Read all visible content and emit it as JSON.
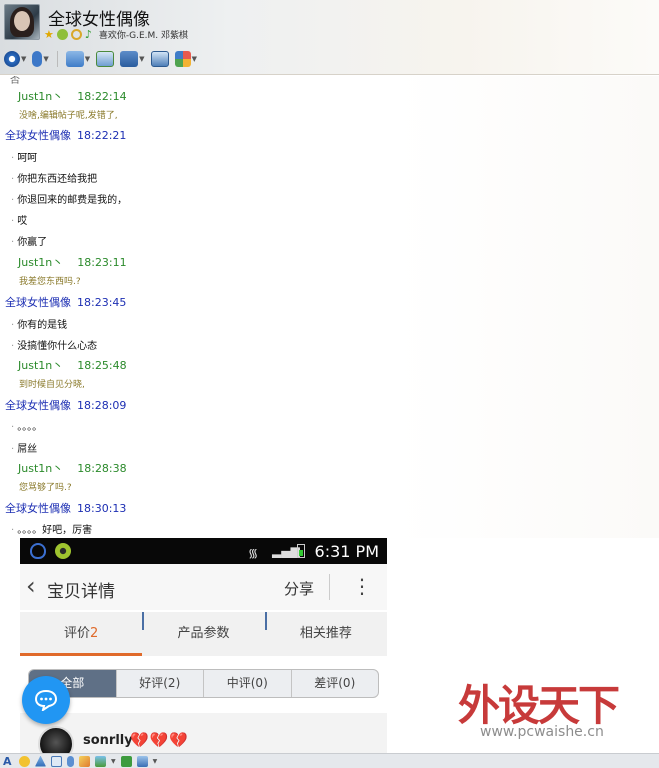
{
  "window": {
    "title": "全球女性偶像",
    "signature": "喜欢你-G.E.M. 邓紫棋"
  },
  "chat": {
    "cutoff_text": "否 ",
    "messages": [
      {
        "sender": "Just1n丶",
        "time": "18:22:14",
        "self": true,
        "lines": [
          "没啥,编辑帖子呢,发错了,"
        ]
      },
      {
        "sender": "全球女性偶像",
        "time": "18:22:21",
        "self": false,
        "lines": [
          "呵呵",
          "你把东西还给我把",
          "你退回来的邮费是我的，",
          "哎",
          "你赢了"
        ]
      },
      {
        "sender": "Just1n丶",
        "time": "18:23:11",
        "self": true,
        "lines": [
          "我差您东西吗.?"
        ]
      },
      {
        "sender": "全球女性偶像",
        "time": "18:23:45",
        "self": false,
        "lines": [
          "你有的是钱",
          "没搞懂你什么心态"
        ]
      },
      {
        "sender": "Just1n丶",
        "time": "18:25:48",
        "self": true,
        "lines": [
          "到时候自见分晓,"
        ]
      },
      {
        "sender": "全球女性偶像",
        "time": "18:28:09",
        "self": false,
        "lines": [
          "。。。。",
          "屌丝"
        ]
      },
      {
        "sender": "Just1n丶",
        "time": "18:28:38",
        "self": true,
        "lines": [
          "您骂够了吗.?"
        ]
      },
      {
        "sender": "全球女性偶像",
        "time": "18:30:13",
        "self": false,
        "lines": [
          "。。。。好吧，厉害"
        ]
      }
    ]
  },
  "phone": {
    "status_time": "6:31 PM",
    "page_title": "宝贝详情",
    "share_label": "分享",
    "tabs": [
      {
        "label": "评价",
        "count": "2"
      },
      {
        "label": "产品参数",
        "count": ""
      },
      {
        "label": "相关推荐",
        "count": ""
      }
    ],
    "filters": [
      "全部",
      "好评(2)",
      "中评(0)",
      "差评(0)"
    ],
    "review": {
      "username": "sonrlly",
      "hearts": "💔💔💔"
    }
  },
  "watermark": {
    "text": "外设天下",
    "url": "www.pcwaishe.cn"
  },
  "colors": {
    "self_name": "#2b8a2b",
    "other_name": "#1d2fb3",
    "accent_tab": "#e06a2a",
    "float_button": "#2196f3"
  },
  "icons": {
    "toolbar": [
      "video-call-icon",
      "voice-call-icon",
      "file-transfer-icon",
      "add-contact-icon",
      "screen-share-icon",
      "remote-desktop-icon",
      "apps-icon"
    ],
    "bottombar": [
      "font-icon",
      "emoji-icon",
      "shake-icon",
      "screenshot-icon",
      "voice-message-icon",
      "doodle-icon",
      "image-icon",
      "music-icon",
      "record-icon"
    ]
  }
}
